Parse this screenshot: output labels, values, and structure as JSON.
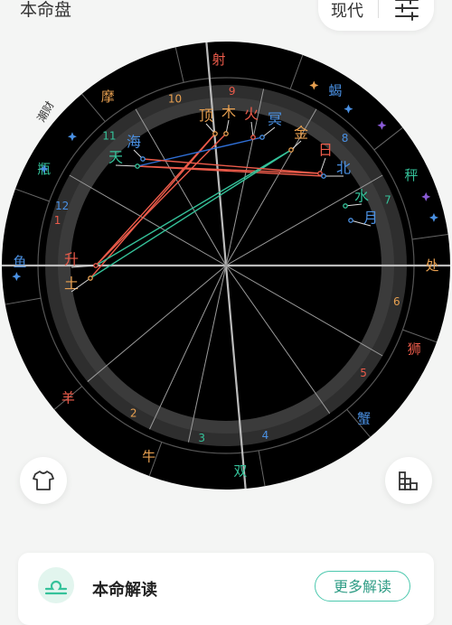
{
  "header": {
    "title": "本命盘",
    "mode_label": "现代"
  },
  "signs": [
    {
      "name": "射",
      "color": "#ec5b4a"
    },
    {
      "name": "蝎",
      "color": "#4a90e2"
    },
    {
      "name": "秤",
      "color": "#35c29a"
    },
    {
      "name": "处",
      "color": "#e8a050"
    },
    {
      "name": "狮",
      "color": "#ec5b4a"
    },
    {
      "name": "蟹",
      "color": "#4a90e2"
    },
    {
      "name": "双",
      "color": "#35c29a"
    },
    {
      "name": "牛",
      "color": "#e8a050"
    },
    {
      "name": "羊",
      "color": "#ec5b4a"
    },
    {
      "name": "鱼",
      "color": "#4a90e2"
    },
    {
      "name": "瓶",
      "color": "#35c29a"
    },
    {
      "name": "摩",
      "color": "#e8a050"
    }
  ],
  "houses": [
    "1",
    "2",
    "3",
    "4",
    "5",
    "6",
    "7",
    "8",
    "9",
    "10",
    "11",
    "12"
  ],
  "house_colors": [
    "#ec5b4a",
    "#e8a050",
    "#35c29a",
    "#4a90e2",
    "#ec5b4a",
    "#e8a050",
    "#35c29a",
    "#4a90e2",
    "#ec5b4a",
    "#e8a050",
    "#35c29a",
    "#4a90e2"
  ],
  "planets": [
    {
      "name": "顶",
      "color": "#e8a050"
    },
    {
      "name": "木",
      "color": "#e8a050"
    },
    {
      "name": "火",
      "color": "#ec5b4a"
    },
    {
      "name": "冥",
      "color": "#4a90e2"
    },
    {
      "name": "海",
      "color": "#4a90e2"
    },
    {
      "name": "金",
      "color": "#e8a050"
    },
    {
      "name": "天",
      "color": "#35c29a"
    },
    {
      "name": "日",
      "color": "#ec5b4a"
    },
    {
      "name": "北",
      "color": "#4a90e2"
    },
    {
      "name": "水",
      "color": "#35c29a"
    },
    {
      "name": "月",
      "color": "#4a90e2"
    },
    {
      "name": "升",
      "color": "#ec5b4a"
    },
    {
      "name": "土",
      "color": "#e8a050"
    }
  ],
  "watermark": "潮财",
  "colors": {
    "red": "#ec5b4a",
    "green": "#35c29a",
    "blue": "#2f6fd6",
    "accent": "#4cc8ae"
  },
  "icons": {
    "filter": "sliders-icon",
    "shirt": "tshirt-icon",
    "stats": "bar-chart-icon",
    "libra": "libra-icon"
  },
  "card": {
    "title": "本命解读",
    "more_label": "更多解读"
  }
}
